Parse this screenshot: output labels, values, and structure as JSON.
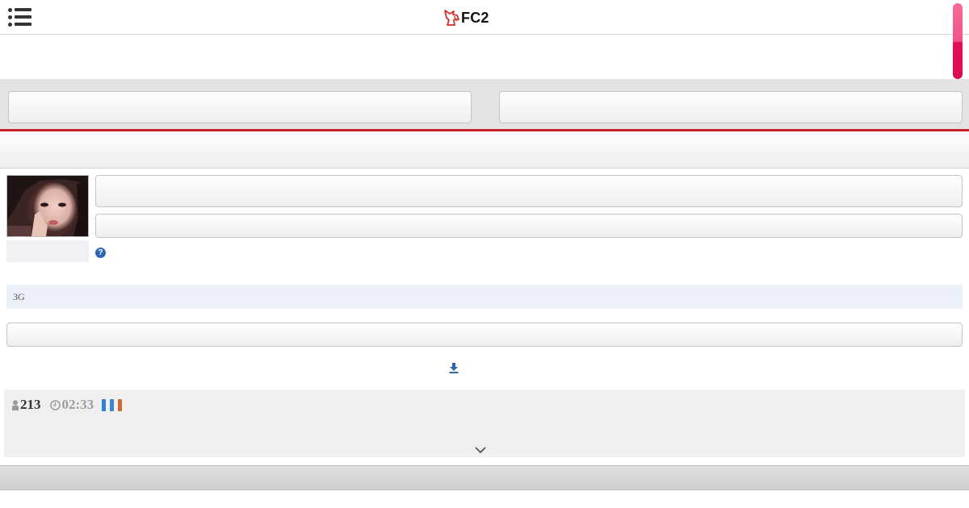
{
  "header": {
    "logo_text": "FC2",
    "menu_icon": "list-menu-icon",
    "logo_icon": "fc2-unicorn-icon"
  },
  "video": {
    "quality_label": "3G",
    "views": "213",
    "duration": "02:33",
    "help_label": "?",
    "icons": {
      "views": "person-icon",
      "duration": "clock-icon",
      "download": "download-icon",
      "expand": "chevron-down-icon"
    },
    "quality_bars": [
      {
        "color": "#2f7fd8"
      },
      {
        "color": "#3d84d0"
      },
      {
        "color": "#d06a35"
      }
    ]
  },
  "colors": {
    "accent_red": "#c71f26",
    "scrollbar_pink": "#e0105a",
    "help_blue": "#2f66b3",
    "quality_bg": "#ebf0fa"
  }
}
